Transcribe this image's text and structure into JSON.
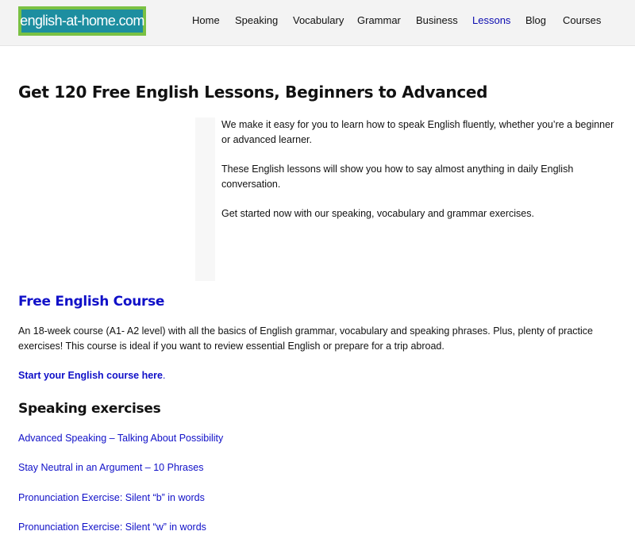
{
  "header": {
    "logo_text": "english-at-home.com",
    "nav": [
      "Home",
      "Speaking",
      "Vocabulary",
      "Grammar",
      "Business",
      "Lessons",
      "Blog",
      "Courses"
    ],
    "active_nav": "Lessons"
  },
  "main": {
    "title": "Get 120 Free English Lessons, Beginners to Advanced",
    "intro": [
      "We make it easy for you to learn how to speak English fluently, whether you’re a beginner or advanced learner.",
      "These English lessons will show you how to say almost anything in daily English conversation.",
      "Get started now with our speaking, vocabulary and grammar exercises."
    ],
    "course": {
      "heading": "Free English Course",
      "description": "An 18-week course (A1- A2 level) with all the basics of English grammar, vocabulary and speaking phrases. Plus, plenty of practice exercises! This course is ideal if you want to review essential English or prepare for a trip abroad.",
      "start_link": "Start your English course here",
      "start_period": "."
    },
    "speaking": {
      "heading": "Speaking exercises",
      "links": [
        "Advanced Speaking – Talking About Possibility",
        "Stay Neutral in an Argument – 10 Phrases",
        "Pronunciation Exercise: Silent “b” in words",
        "Pronunciation Exercise: Silent “w” in words"
      ]
    }
  },
  "colors": {
    "link_blue": "#1010c8",
    "logo_background": "#1d8ea0",
    "logo_border": "#7ac143",
    "header_background": "#f3f3f3"
  }
}
